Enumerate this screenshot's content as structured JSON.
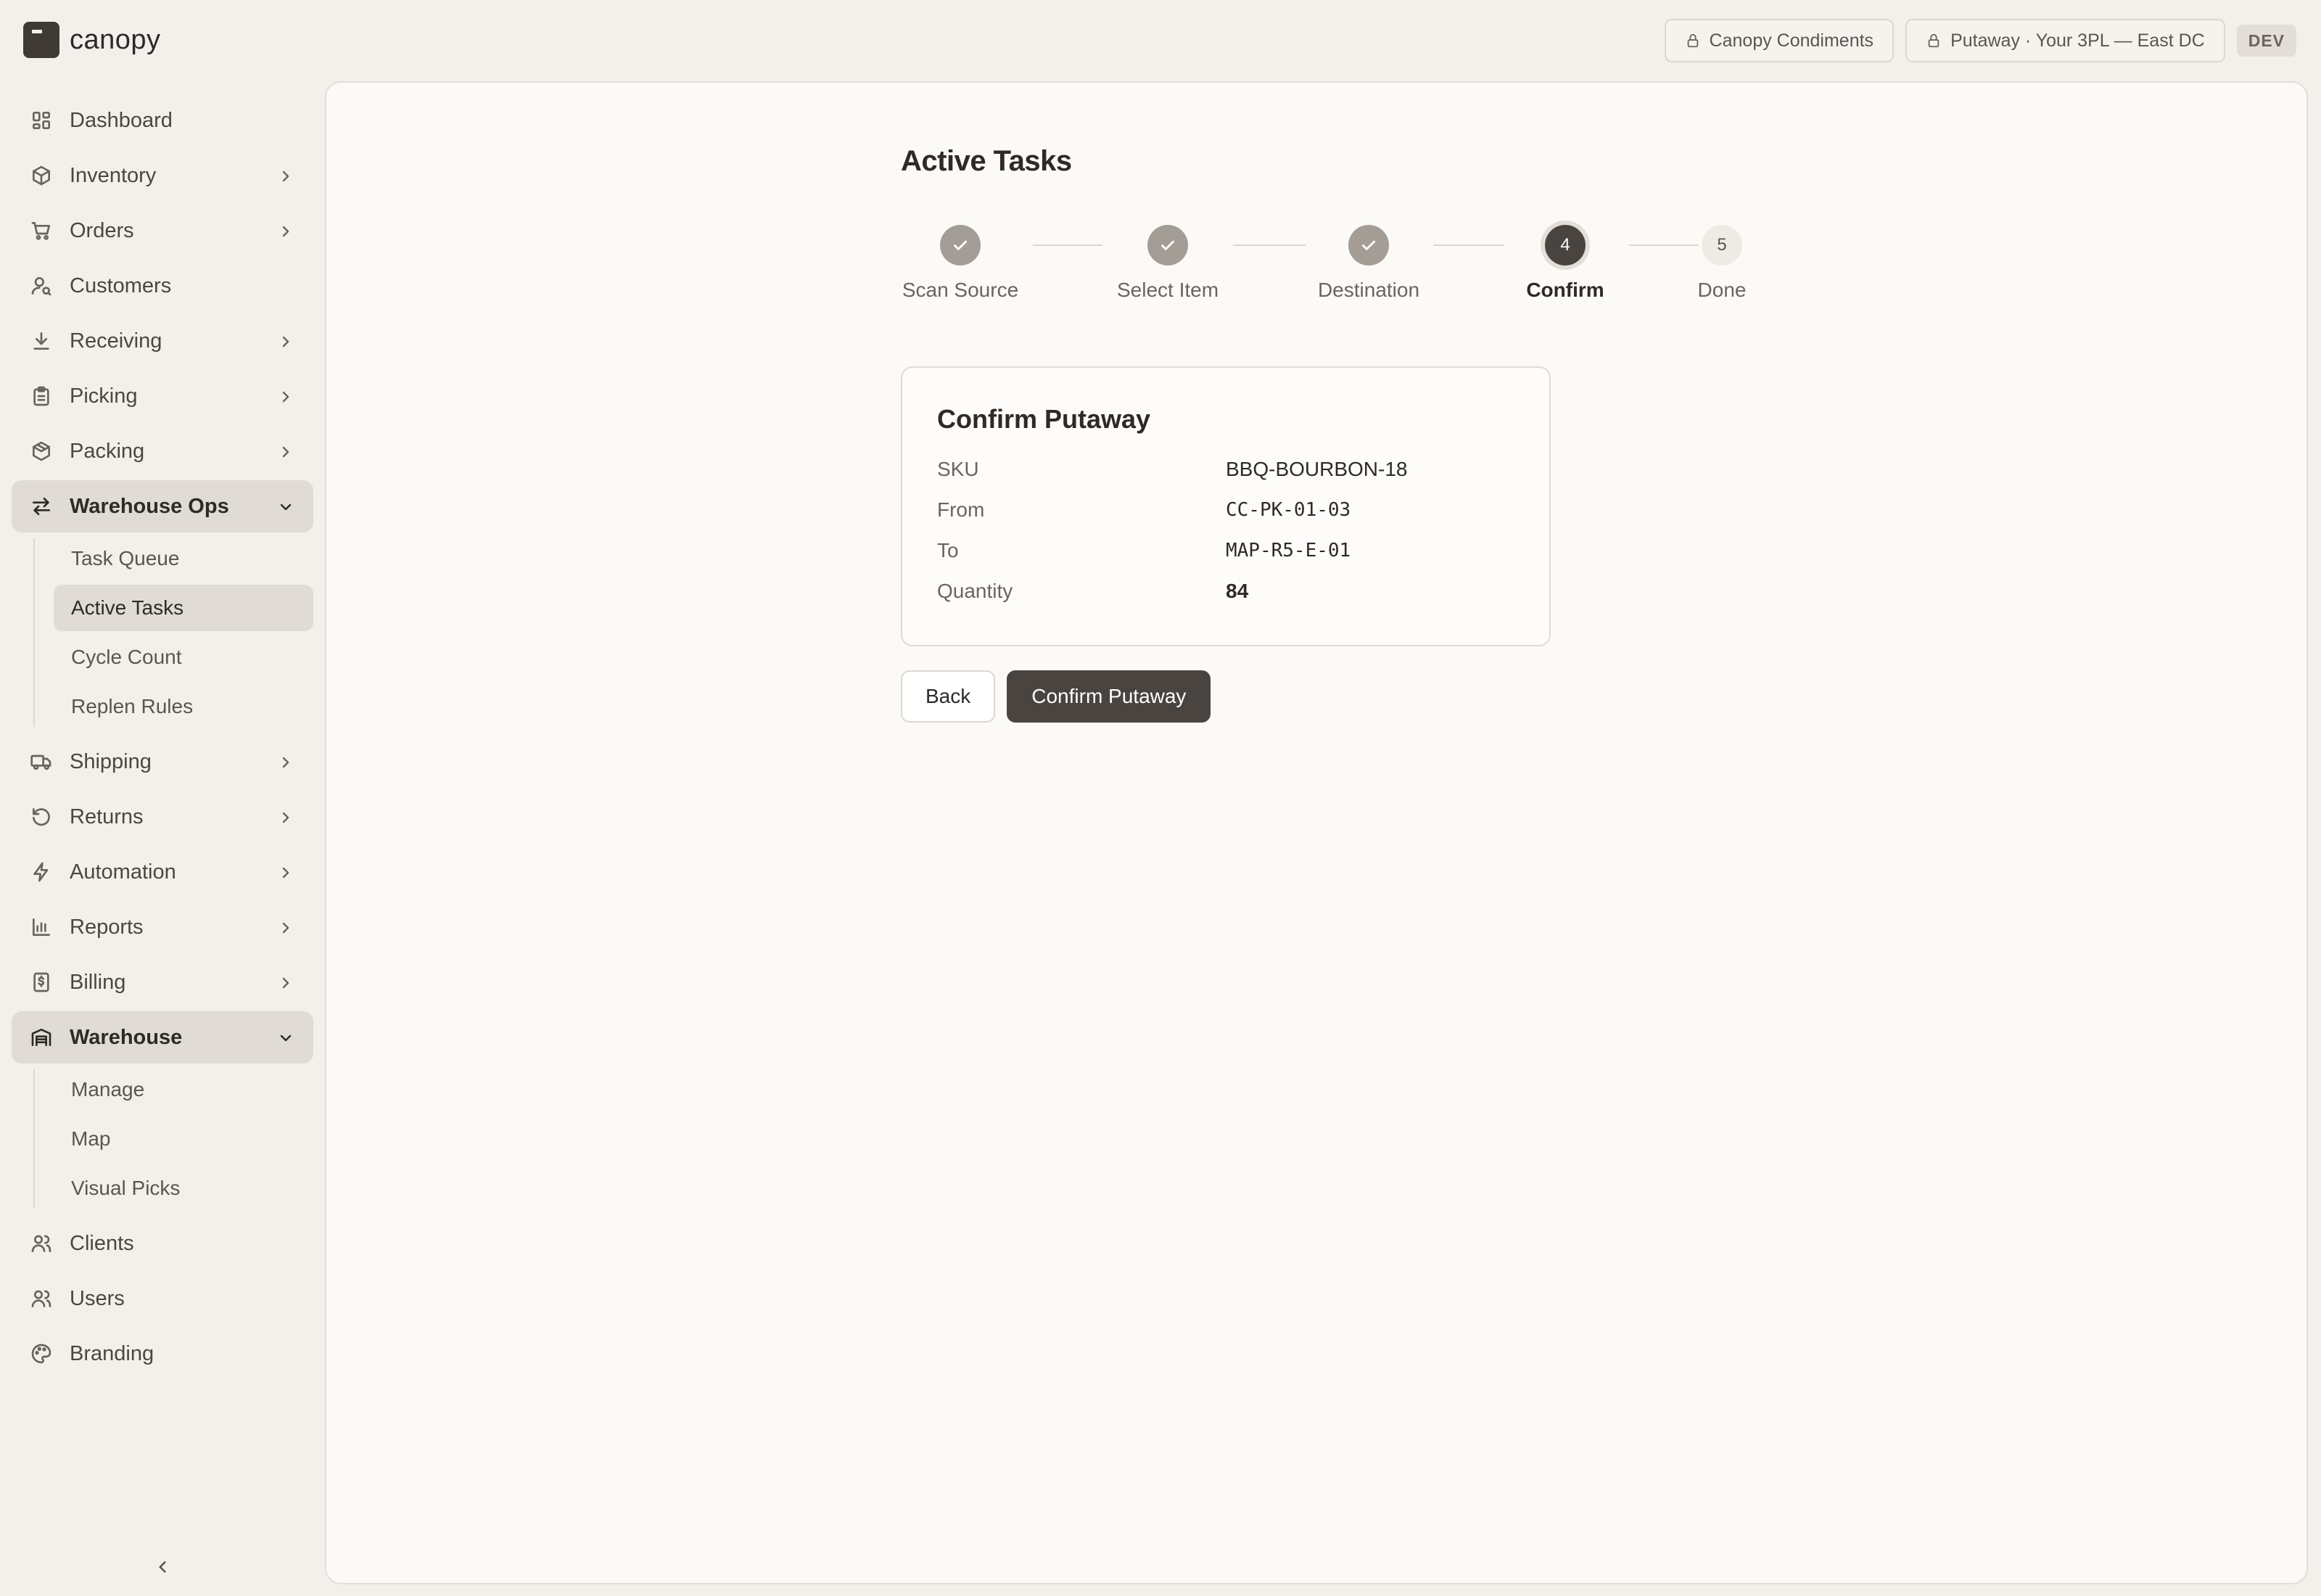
{
  "brand": {
    "name": "canopy"
  },
  "topbar": {
    "client_pill": "Canopy Condiments",
    "context_pill": "Putaway · Your 3PL — East DC",
    "env_badge": "DEV"
  },
  "sidebar": {
    "items": [
      {
        "label": "Dashboard",
        "icon": "dashboard-icon"
      },
      {
        "label": "Inventory",
        "icon": "box-icon"
      },
      {
        "label": "Orders",
        "icon": "cart-icon"
      },
      {
        "label": "Customers",
        "icon": "customer-icon"
      },
      {
        "label": "Receiving",
        "icon": "download-icon"
      },
      {
        "label": "Picking",
        "icon": "clipboard-icon"
      },
      {
        "label": "Packing",
        "icon": "package-icon"
      },
      {
        "label": "Warehouse Ops",
        "icon": "arrows-exchange-icon"
      },
      {
        "label": "Shipping",
        "icon": "truck-icon"
      },
      {
        "label": "Returns",
        "icon": "rotate-ccw-icon"
      },
      {
        "label": "Automation",
        "icon": "bolt-icon"
      },
      {
        "label": "Reports",
        "icon": "bar-chart-icon"
      },
      {
        "label": "Billing",
        "icon": "dollar-receipt-icon"
      },
      {
        "label": "Warehouse",
        "icon": "warehouse-icon"
      },
      {
        "label": "Clients",
        "icon": "users-icon"
      },
      {
        "label": "Users",
        "icon": "users-icon"
      },
      {
        "label": "Branding",
        "icon": "palette-icon"
      }
    ],
    "warehouse_ops_sub": [
      "Task Queue",
      "Active Tasks",
      "Cycle Count",
      "Replen Rules"
    ],
    "warehouse_sub": [
      "Manage",
      "Map",
      "Visual Picks"
    ]
  },
  "page": {
    "title": "Active Tasks",
    "steps": [
      {
        "label": "Scan Source",
        "state": "done"
      },
      {
        "label": "Select Item",
        "state": "done"
      },
      {
        "label": "Destination",
        "state": "done"
      },
      {
        "label": "Confirm",
        "number": "4",
        "state": "current"
      },
      {
        "label": "Done",
        "number": "5",
        "state": "todo"
      }
    ],
    "card": {
      "title": "Confirm Putaway",
      "rows": [
        {
          "key": "SKU",
          "value": "BBQ-BOURBON-18"
        },
        {
          "key": "From",
          "value": "CC-PK-01-03"
        },
        {
          "key": "To",
          "value": "MAP-R5-E-01"
        },
        {
          "key": "Quantity",
          "value": "84"
        }
      ]
    },
    "actions": {
      "back": "Back",
      "confirm": "Confirm Putaway"
    }
  },
  "colors": {
    "accent": "#4a4440",
    "background": "#f3f0eb",
    "surface": "#fbfaf7"
  }
}
